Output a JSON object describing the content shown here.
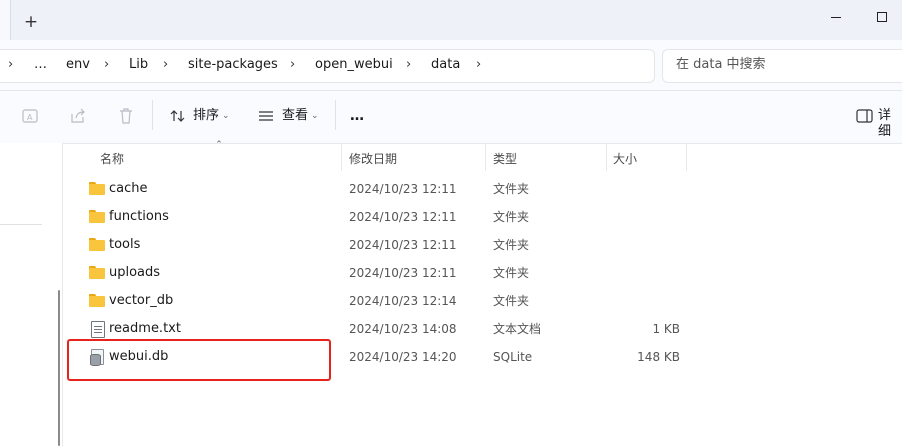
{
  "colors": {
    "highlight": "#e8231b",
    "folder": "#f8c53c",
    "tabbar_bg": "#eef1f8"
  },
  "tabbar": {
    "new_tab": "+"
  },
  "breadcrumb": {
    "items": [
      "…",
      "env",
      "Lib",
      "site-packages",
      "open_webui",
      "data"
    ],
    "separator": "›"
  },
  "search": {
    "placeholder": "在 data 中搜索"
  },
  "toolbar": {
    "sort_label": "排序",
    "view_label": "查看",
    "more_label": "…",
    "details_label": "详细"
  },
  "columns": {
    "name": "名称",
    "modified": "修改日期",
    "type": "类型",
    "size": "大小"
  },
  "files": [
    {
      "name": "cache",
      "modified": "2024/10/23 12:11",
      "type": "文件夹",
      "size": "",
      "icon": "folder-icon"
    },
    {
      "name": "functions",
      "modified": "2024/10/23 12:11",
      "type": "文件夹",
      "size": "",
      "icon": "folder-icon"
    },
    {
      "name": "tools",
      "modified": "2024/10/23 12:11",
      "type": "文件夹",
      "size": "",
      "icon": "folder-icon"
    },
    {
      "name": "uploads",
      "modified": "2024/10/23 12:11",
      "type": "文件夹",
      "size": "",
      "icon": "folder-icon"
    },
    {
      "name": "vector_db",
      "modified": "2024/10/23 12:14",
      "type": "文件夹",
      "size": "",
      "icon": "folder-icon"
    },
    {
      "name": "readme.txt",
      "modified": "2024/10/23 14:08",
      "type": "文本文档",
      "size": "1 KB",
      "icon": "text-file-icon"
    },
    {
      "name": "webui.db",
      "modified": "2024/10/23 14:20",
      "type": "SQLite",
      "size": "148 KB",
      "icon": "database-file-icon"
    }
  ]
}
